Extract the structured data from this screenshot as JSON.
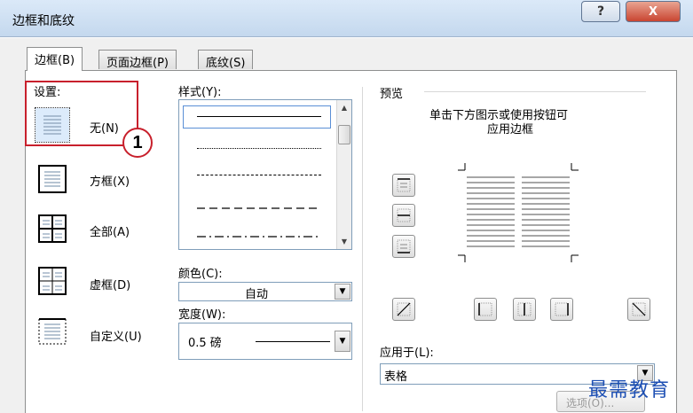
{
  "window": {
    "title": "边框和底纹",
    "help_label": "?",
    "close_label": "X"
  },
  "tabs": [
    {
      "label": "边框(B)",
      "active": true
    },
    {
      "label": "页面边框(P)",
      "active": false
    },
    {
      "label": "底纹(S)",
      "active": false
    }
  ],
  "settings": {
    "label": "设置:",
    "items": [
      {
        "label": "无(N)",
        "icon": "border-none-icon",
        "selected": true
      },
      {
        "label": "方框(X)",
        "icon": "border-box-icon"
      },
      {
        "label": "全部(A)",
        "icon": "border-all-icon"
      },
      {
        "label": "虚框(D)",
        "icon": "border-grid-icon"
      },
      {
        "label": "自定义(U)",
        "icon": "border-custom-icon"
      }
    ]
  },
  "callout": {
    "number": "1",
    "color": "#c8202c"
  },
  "style": {
    "label": "样式(Y):",
    "line_styles": [
      "solid",
      "dotted",
      "dashed-fine",
      "dashed",
      "dash-dot"
    ]
  },
  "color": {
    "label": "颜色(C):",
    "value": "自动"
  },
  "width": {
    "label": "宽度(W):",
    "value": "0.5 磅"
  },
  "preview": {
    "label": "预览",
    "hint_line1": "单击下方图示或使用按钮可",
    "hint_line2": "应用边框"
  },
  "apply_to": {
    "label": "应用于(L):",
    "value": "表格"
  },
  "options_button": {
    "label": "选项(O)..."
  },
  "watermark": {
    "text": "最需教育",
    "color": "#1d4fb3"
  }
}
